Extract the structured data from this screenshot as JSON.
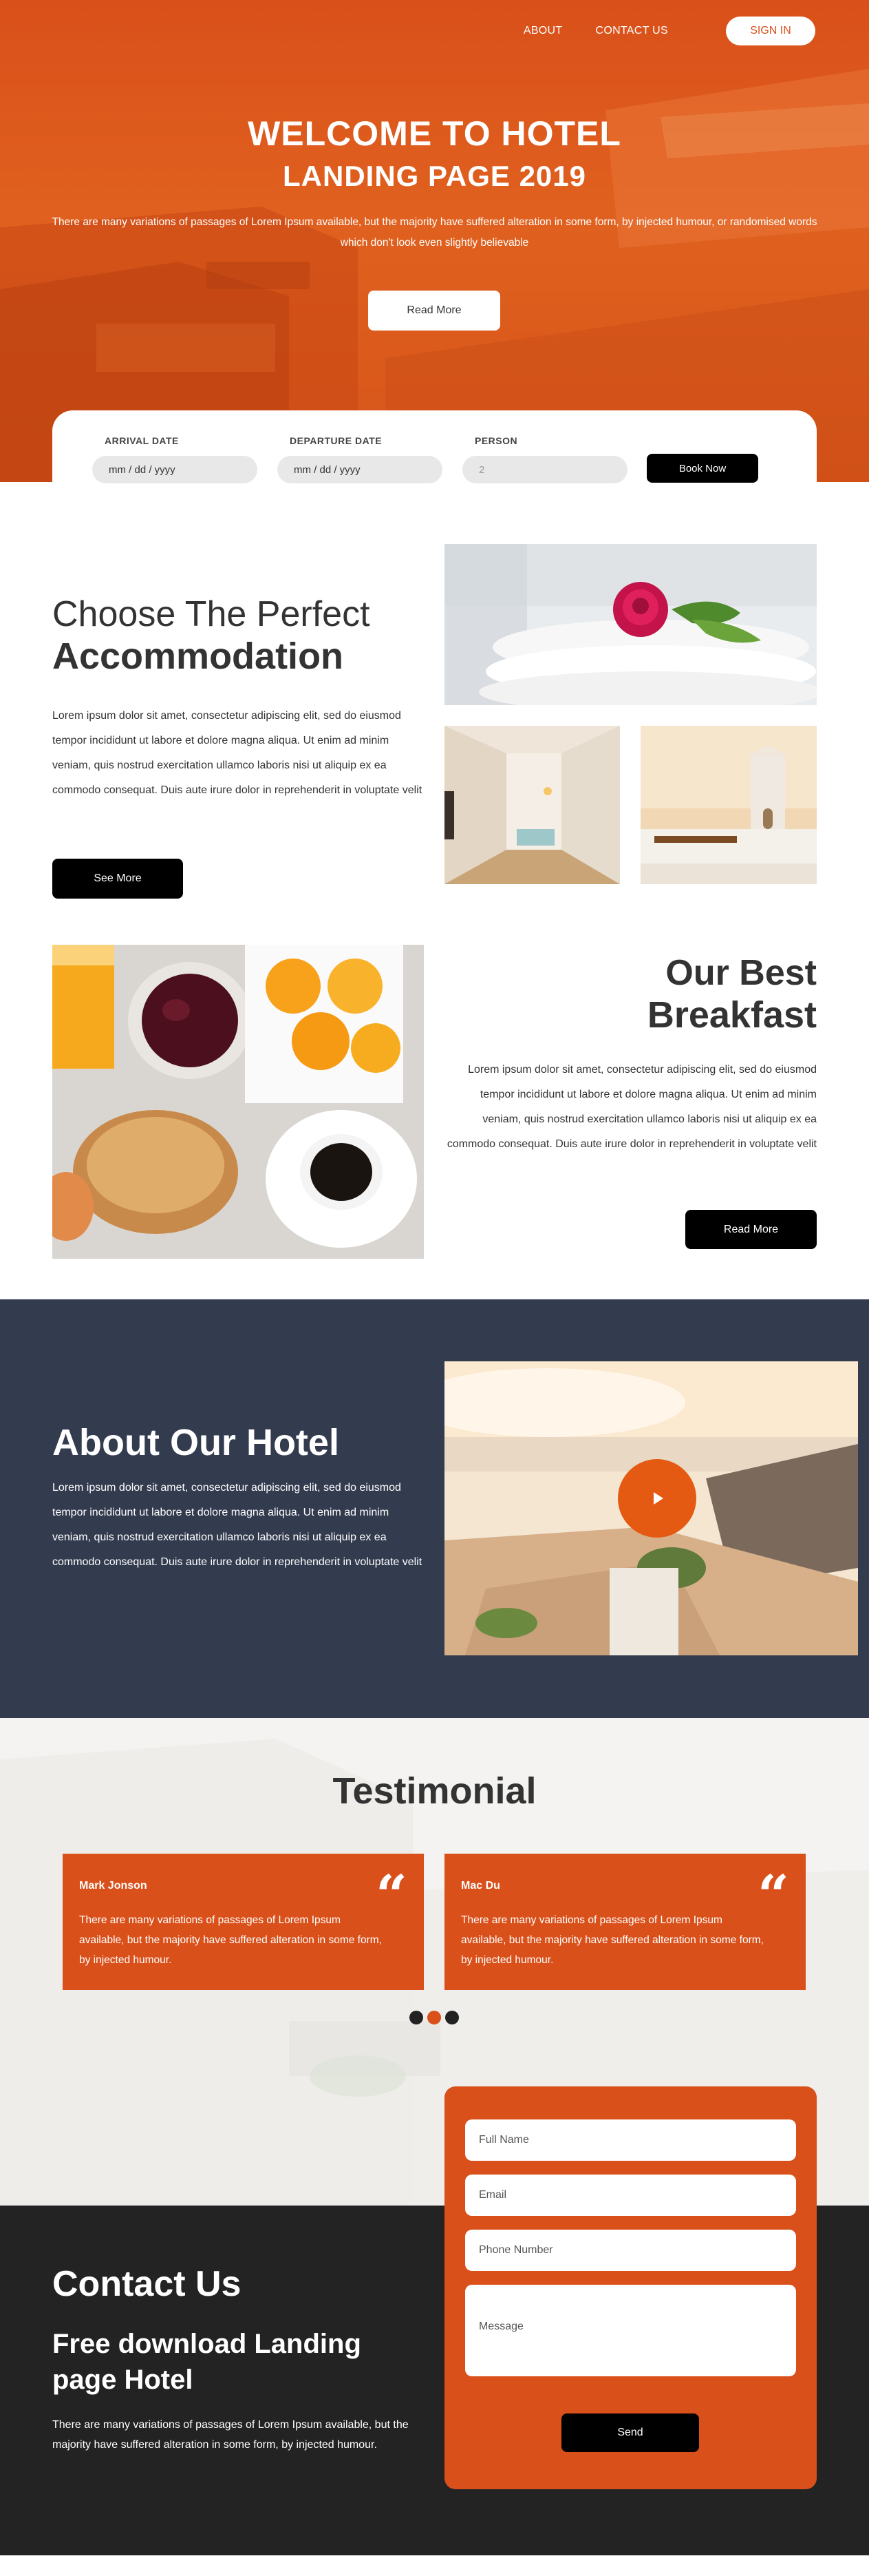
{
  "nav": {
    "about": "ABOUT",
    "contact": "CONTACT US",
    "signin": "SIGN IN"
  },
  "hero": {
    "title": "WELCOME TO HOTEL",
    "subtitle": "LANDING PAGE 2019",
    "text": "There are many variations of passages of Lorem Ipsum available, but the majority have suffered alteration in some form, by injected humour, or randomised words which don't look even slightly believable",
    "button": "Read More"
  },
  "booking": {
    "arrival_label": "ARRIVAL DATE",
    "arrival_placeholder": "mm / dd / yyyy",
    "departure_label": "DEPARTURE DATE",
    "departure_placeholder": "mm / dd / yyyy",
    "person_label": "PERSON",
    "person_value": "2",
    "button": "Book Now"
  },
  "accommodation": {
    "title_light": "Choose The Perfect",
    "title_bold": "Accommodation",
    "text": "Lorem ipsum dolor sit amet, consectetur adipiscing elit, sed do eiusmod tempor incididunt ut labore et dolore magna aliqua. Ut enim ad minim veniam, quis nostrud exercitation ullamco laboris nisi ut aliquip ex ea commodo consequat. Duis aute irure dolor in reprehenderit in voluptate velit",
    "button": "See More"
  },
  "breakfast": {
    "title_light": "Our Best",
    "title_bold": "Breakfast",
    "text": "Lorem ipsum dolor sit amet, consectetur adipiscing elit, sed do eiusmod tempor incididunt ut labore et dolore magna aliqua. Ut enim ad minim veniam, quis nostrud exercitation ullamco laboris nisi ut aliquip ex ea commodo consequat. Duis aute irure dolor in reprehenderit in voluptate velit",
    "button": "Read More"
  },
  "about": {
    "title": "About Our Hotel",
    "text": "Lorem ipsum dolor sit amet, consectetur adipiscing elit, sed do eiusmod tempor incididunt ut labore et dolore magna aliqua. Ut enim ad minim veniam, quis nostrud exercitation ullamco laboris nisi ut aliquip ex ea commodo consequat. Duis aute irure dolor in reprehenderit in voluptate velit"
  },
  "testimonial": {
    "title": "Testimonial",
    "cards": [
      {
        "name": "Mark Jonson",
        "text": "There are many variations of passages of Lorem Ipsum available, but the majority have suffered alteration in some form, by injected humour."
      },
      {
        "name": "Mac Du",
        "text": "There are many variations of passages of Lorem Ipsum available, but the majority have suffered alteration in some form, by injected humour."
      }
    ],
    "active_dot": 2
  },
  "contact": {
    "title": "Contact Us",
    "subtitle": "Free download Landing page Hotel",
    "text": "There are many variations of passages of Lorem Ipsum available, but the majority have suffered alteration in some form, by injected humour.",
    "form": {
      "name_placeholder": "Full Name",
      "email_placeholder": "Email",
      "phone_placeholder": "Phone Number",
      "message_placeholder": "Message",
      "send": "Send"
    }
  },
  "colors": {
    "accent": "#d9501a",
    "dark_navy": "#333c4f",
    "footer_dark": "#232323"
  }
}
